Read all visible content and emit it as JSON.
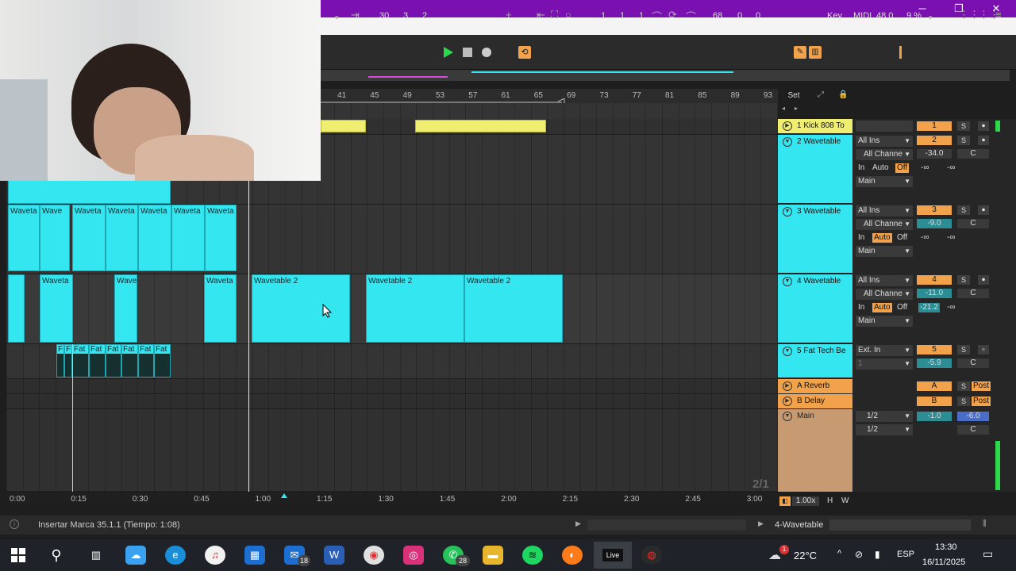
{
  "window": {
    "minimize": "─",
    "maximize": "❐",
    "close": "✕"
  },
  "transport": {
    "arrangement_pos": [
      "30",
      "3",
      "2"
    ],
    "loop_start": [
      "1",
      "1",
      "1"
    ],
    "loop_length": [
      "68",
      "0",
      "0"
    ],
    "key_label": "Key",
    "midi_label": "MIDI",
    "midi_value": "48.0",
    "cpu_value": "9 %"
  },
  "ruler": [
    "41",
    "45",
    "49",
    "53",
    "57",
    "61",
    "65",
    "69",
    "73",
    "77",
    "81",
    "85",
    "89",
    "93"
  ],
  "set_label": "Set",
  "clip_labels": {
    "wave_row2": [
      "Waveta",
      "Wave",
      "Waveta",
      "Waveta",
      "Waveta",
      "Waveta",
      "Waveta"
    ],
    "wave_row3": [
      "Waveta",
      "Wave",
      "Waveta",
      "Wavetable 2",
      "Wavetable 2",
      "Wavetable 2"
    ],
    "fat_row": [
      "F",
      "F",
      "Fat",
      "Fat",
      "Fat",
      "Fat",
      "Fat",
      "Fat"
    ]
  },
  "tracks": [
    {
      "name": "1 Kick 808 To",
      "number": "1",
      "solo": "S"
    },
    {
      "name": "2 Wavetable",
      "number": "2",
      "solo": "S",
      "input": "All Ins",
      "channel": "All Channe",
      "monitor": [
        "In",
        "Auto",
        "Off"
      ],
      "output": "Main",
      "volume": "-34.0",
      "pan": "C",
      "sends": [
        "-∞",
        "-∞"
      ]
    },
    {
      "name": "3 Wavetable",
      "number": "3",
      "solo": "S",
      "input": "All Ins",
      "channel": "All Channe",
      "monitor": [
        "In",
        "Auto",
        "Off"
      ],
      "output": "Main",
      "volume": "-9.0",
      "pan": "C",
      "sends": [
        "-∞",
        "-∞"
      ]
    },
    {
      "name": "4 Wavetable",
      "number": "4",
      "solo": "S",
      "input": "All Ins",
      "channel": "All Channe",
      "monitor": [
        "In",
        "Auto",
        "Off"
      ],
      "output": "Main",
      "volume": "-11.0",
      "pan": "C",
      "sends": [
        "-21.2",
        "-∞"
      ]
    },
    {
      "name": "5 Fat Tech Be",
      "number": "5",
      "solo": "S",
      "input": "Ext. In",
      "channel": "1",
      "volume": "-5.9",
      "pan": "C"
    }
  ],
  "returns": [
    {
      "name": "A Reverb",
      "letter": "A",
      "solo": "S",
      "post": "Post"
    },
    {
      "name": "B Delay",
      "letter": "B",
      "solo": "S",
      "post": "Post"
    }
  ],
  "main": {
    "name": "Main",
    "out1": "1/2",
    "out2": "1/2",
    "volume": "-1.0",
    "cue": "-6.0",
    "pan": "C"
  },
  "zoom_label": "2/1",
  "time_ruler": [
    "0:00",
    "0:15",
    "0:30",
    "0:45",
    "1:00",
    "1:15",
    "1:30",
    "1:45",
    "2:00",
    "2:15",
    "2:30",
    "2:45",
    "3:00"
  ],
  "tempo_zoom": "1.00x",
  "hw": [
    "H",
    "W"
  ],
  "status": {
    "message": "Insertar Marca 35.1.1 (Tiempo: 1:08)",
    "selected_track": "4-Wavetable"
  },
  "taskbar": {
    "mail_badge": "18",
    "whatsapp_badge": "28",
    "live_label": "Live",
    "weather": "22°C",
    "lang": "ESP",
    "time": "13:30",
    "date": "16/11/2025",
    "notif_badge": "1"
  },
  "colors": {
    "accent_orange": "#f1a24a",
    "clip_cyan": "#34e6f0",
    "clip_yellow": "#f0ee70",
    "title_purple": "#7a10b0",
    "play_green": "#2dd84a"
  }
}
